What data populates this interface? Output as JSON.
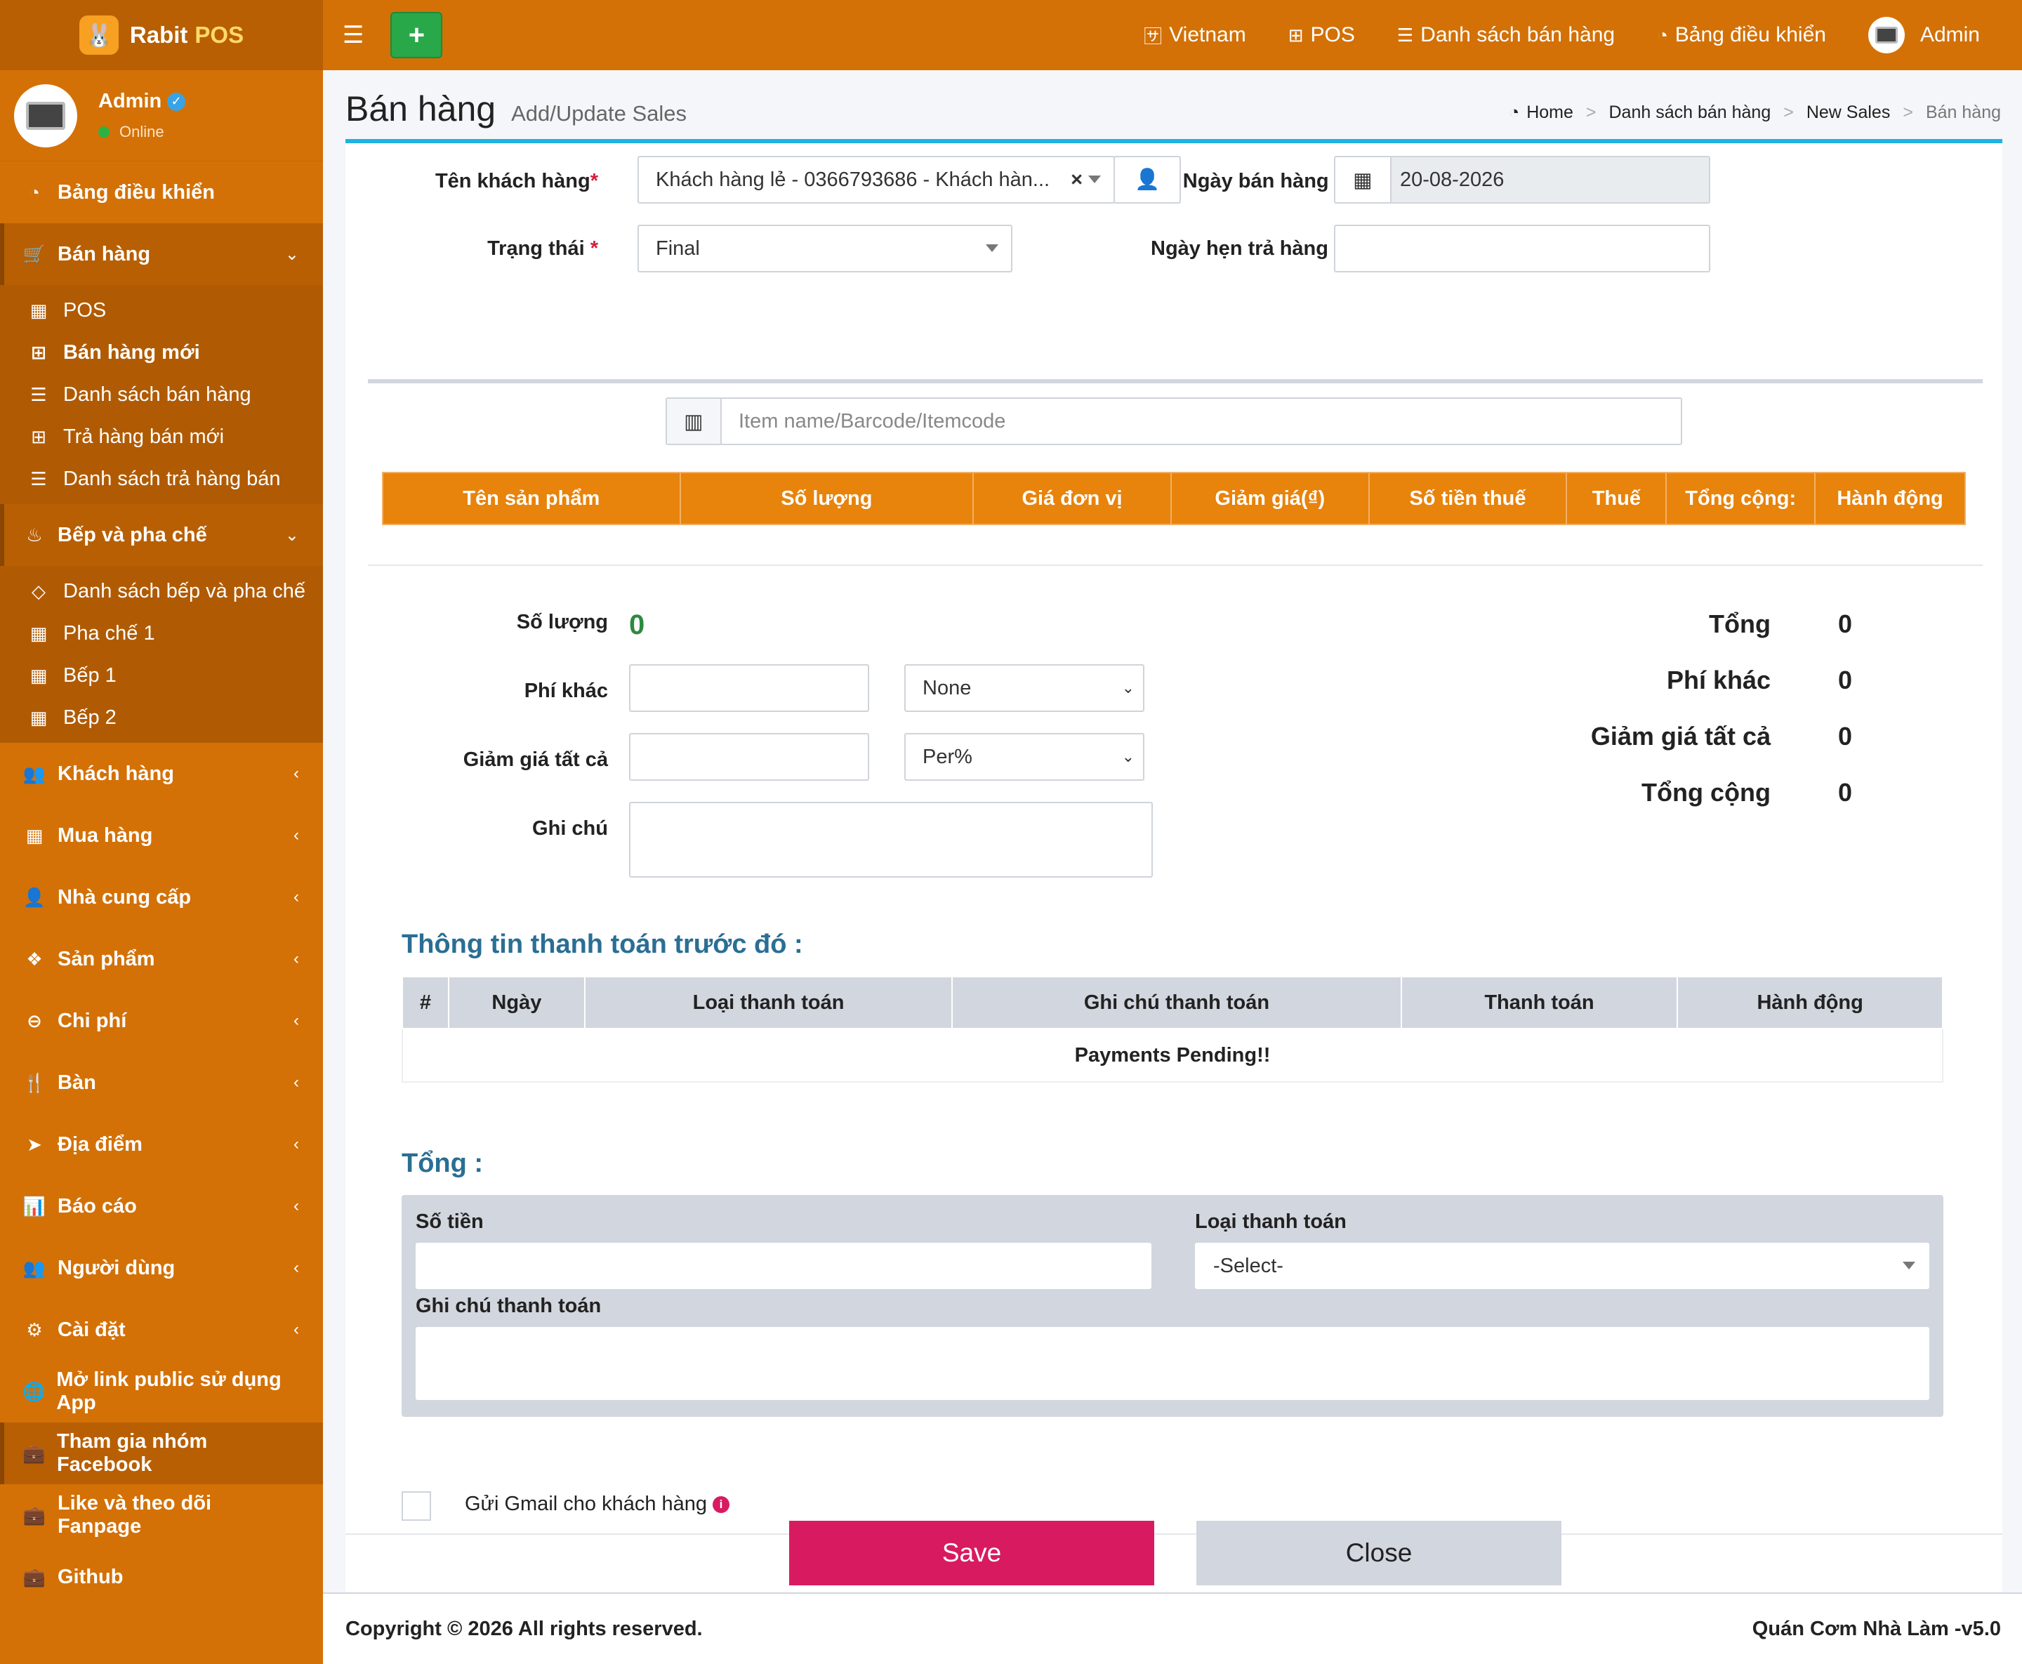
{
  "brand": {
    "name": "Rabit",
    "name2": "POS"
  },
  "user": {
    "name": "Admin",
    "status": "Online"
  },
  "sidebar": {
    "items": [
      {
        "label": "Bảng điều khiển",
        "icon": "dashboard-icon"
      },
      {
        "label": "Bán hàng",
        "icon": "cart-icon"
      },
      {
        "label": "Bếp và pha chế",
        "icon": "kitchen-icon"
      },
      {
        "label": "Khách hàng",
        "icon": "users-icon"
      },
      {
        "label": "Mua hàng",
        "icon": "grid-icon"
      },
      {
        "label": "Nhà cung cấp",
        "icon": "user-plus-icon"
      },
      {
        "label": "Sản phẩm",
        "icon": "cubes-icon"
      },
      {
        "label": "Chi phí",
        "icon": "minus-circle-icon"
      },
      {
        "label": "Bàn",
        "icon": "cutlery-icon"
      },
      {
        "label": "Địa điểm",
        "icon": "location-arrow-icon"
      },
      {
        "label": "Báo cáo",
        "icon": "bar-chart-icon"
      },
      {
        "label": "Người dùng",
        "icon": "users-icon"
      },
      {
        "label": "Cài đặt",
        "icon": "gears-icon"
      },
      {
        "label": "Mở link public sử dụng App",
        "icon": "globe-icon"
      },
      {
        "label": "Tham gia nhóm Facebook",
        "icon": "briefcase-icon"
      },
      {
        "label": "Like và theo dõi Fanpage",
        "icon": "briefcase-icon"
      },
      {
        "label": "Github",
        "icon": "briefcase-icon"
      }
    ],
    "sales_sub": [
      "POS",
      "Bán hàng mới",
      "Danh sách bán hàng",
      "Trả hàng bán mới",
      "Danh sách trả hàng bán"
    ],
    "kitchen_sub": [
      "Danh sách bếp và pha chế",
      "Pha chế 1",
      "Bếp 1",
      "Bếp 2"
    ]
  },
  "topbar": {
    "items": [
      "Vietnam",
      "POS",
      "Danh sách bán hàng",
      "Bảng điều khiển"
    ],
    "user": "Admin"
  },
  "page": {
    "title": "Bán hàng",
    "subtitle": "Add/Update Sales"
  },
  "breadcrumb": [
    "Home",
    "Danh sách bán hàng",
    "New Sales",
    "Bán hàng"
  ],
  "form": {
    "customer_label": "Tên khách hàng",
    "customer_value": "Khách hàng lẻ - 0366793686 - Khách hàn...",
    "date_label": "Ngày bán hàng",
    "date_value": "20-08-2026",
    "status_label": "Trạng thái",
    "status_value": "Final",
    "return_label": "Ngày hẹn trả hàng",
    "item_placeholder": "Item name/Barcode/Itemcode"
  },
  "items_table": {
    "headers": [
      "Tên sản phẩm",
      "Số lượng",
      "Giá đơn vị",
      "Giảm giá(₫)",
      "Số tiền thuế",
      "Thuế",
      "Tổng cộng:",
      "Hành động"
    ]
  },
  "summary": {
    "qty_label": "Số lượng",
    "qty_value": "0",
    "other_label": "Phí khác",
    "other_select": "None",
    "discount_label": "Giảm giá tất cả",
    "discount_select": "Per%",
    "note_label": "Ghi chú"
  },
  "totals": [
    {
      "label": "Tổng",
      "value": "0"
    },
    {
      "label": "Phí khác",
      "value": "0"
    },
    {
      "label": "Giảm giá tất cả",
      "value": "0"
    },
    {
      "label": "Tổng cộng",
      "value": "0"
    }
  ],
  "prev_payments": {
    "title": "Thông tin thanh toán trước đó :",
    "headers": [
      "#",
      "Ngày",
      "Loại thanh toán",
      "Ghi chú thanh toán",
      "Thanh toán",
      "Hành động"
    ],
    "empty": "Payments Pending!!"
  },
  "payment": {
    "title": "Tổng :",
    "amount_label": "Số tiền",
    "type_label": "Loại thanh toán",
    "type_value": "-Select-",
    "note_label": "Ghi chú thanh toán"
  },
  "email_label": "Gửi Gmail cho khách hàng",
  "buttons": {
    "save": "Save",
    "close": "Close"
  },
  "footer": {
    "copyright": "Copyright © 2026 All rights reserved.",
    "version": "Quán Cơm Nhà Làm -v5.0"
  },
  "colors": {
    "sidebar": "#d37107",
    "accent": "#1fb2e0",
    "save": "#d81b60",
    "table_head": "#e8830b"
  }
}
